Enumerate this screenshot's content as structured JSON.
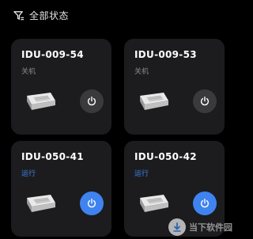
{
  "filter": {
    "label": "全部状态",
    "icon": "filter-icon"
  },
  "devices": [
    {
      "name": "IDU-009-54",
      "status": "关机",
      "state": "off"
    },
    {
      "name": "IDU-009-53",
      "status": "关机",
      "state": "off"
    },
    {
      "name": "IDU-050-41",
      "status": "运行",
      "state": "on"
    },
    {
      "name": "IDU-050-42",
      "status": "运行",
      "state": "on"
    }
  ],
  "watermark": {
    "text": "当下软件园",
    "icon": "download-logo-icon"
  },
  "colors": {
    "background": "#000000",
    "card": "#1c1c1e",
    "accent": "#3f83f0",
    "power_off": "#3a3a3c",
    "status_off": "#8a8a8e"
  }
}
